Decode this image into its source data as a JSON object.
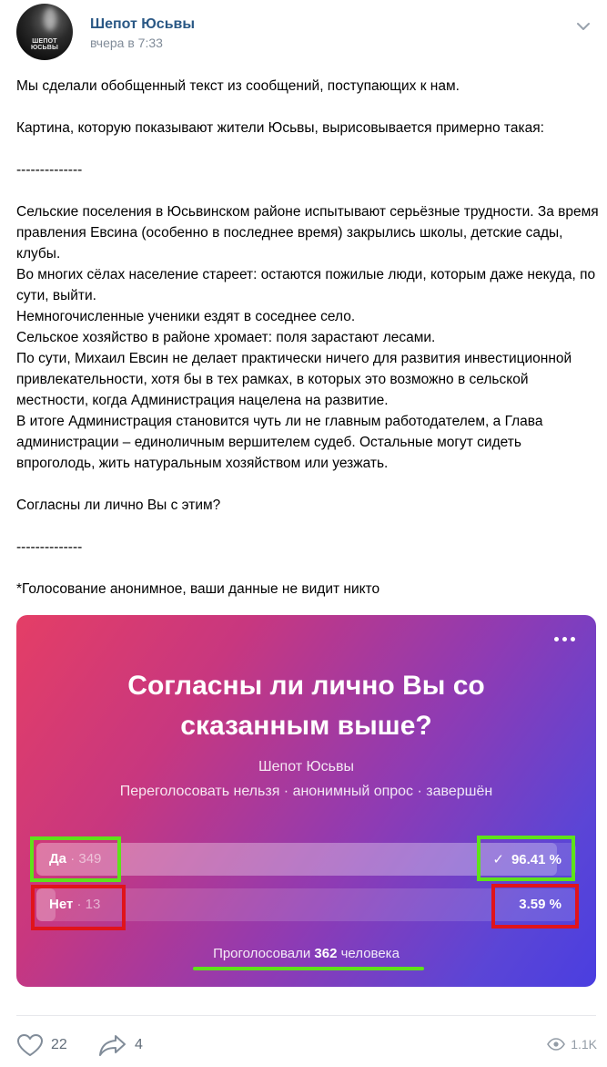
{
  "post": {
    "group_name": "Шепот Юсьвы",
    "time": "вчера в 7:33",
    "avatar_text": "ШЕПОТ ЮСЬВЫ",
    "paragraphs": [
      "Мы сделали обобщенный текст из сообщений, поступающих к нам.",
      "",
      "Картина, которую показывают жители Юсьвы, вырисовывается примерно такая:",
      "",
      "--------------",
      "",
      "Сельские поселения в Юсьвинском районе испытывают серьёзные трудности. За время правления Евсина (особенно в последнее время) закрылись школы, детские сады, клубы.",
      "Во многих сёлах население стареет: остаются пожилые люди, которым даже некуда, по сути, выйти.",
      "Немногочисленные ученики ездят в соседнее село.",
      "Сельское хозяйство в районе хромает: поля зарастают лесами.",
      "По сути, Михаил Евсин не делает практически ничего для развития инвестиционной привлекательности, хотя бы в тех рамках, в которых это возможно в сельской местности, когда Администрация нацелена на развитие.",
      "В итоге Администрация становится чуть ли не главным работодателем, а Глава администрации – единоличным вершителем судеб. Остальные могут сидеть впроголодь, жить натуральным хозяйством или уезжать.",
      "",
      "Согласны ли лично Вы с этим?",
      "",
      "--------------",
      "",
      "*Голосование анонимное, ваши данные не видит никто"
    ]
  },
  "poll": {
    "question_line1": "Согласны ли лично Вы со",
    "question_line2": "сказанным выше?",
    "author": "Шепот Юсьвы",
    "meta": "Переголосовать нельзя · анонимный опрос · завершён",
    "answers": [
      {
        "label": "Да",
        "count": "349",
        "percent": "96.41 %",
        "fraction": 0.9641,
        "voted": true
      },
      {
        "label": "Нет",
        "count": "13",
        "percent": "3.59 %",
        "fraction": 0.0359,
        "voted": false
      }
    ],
    "voted_prefix": "Проголосовали",
    "voted_count": "362",
    "voted_suffix": "человека",
    "check_glyph": "✓"
  },
  "footer": {
    "likes": "22",
    "shares": "4",
    "views": "1.1K"
  },
  "icons": {
    "menu": "chevron-down-icon",
    "like": "heart-icon",
    "share": "share-arrow-icon",
    "views": "eye-icon",
    "more": "more-dots-icon"
  },
  "colors": {
    "link": "#2a5885",
    "muted": "#818c99",
    "gradient_start": "#e43e66",
    "gradient_end": "#4a3ee0",
    "highlight_green": "#5ee21a",
    "highlight_red": "#e0141b"
  }
}
